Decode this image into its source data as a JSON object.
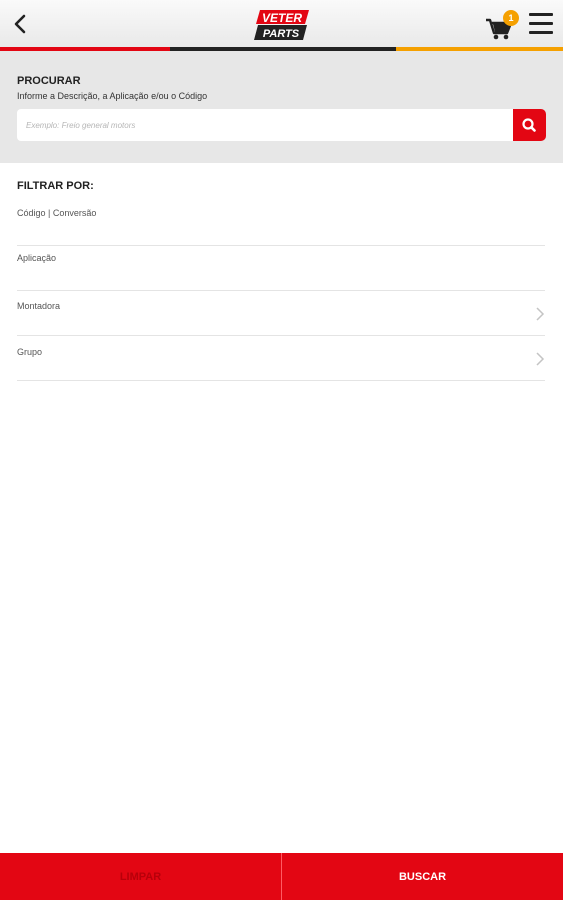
{
  "header": {
    "logo_top": "VETER",
    "logo_bottom": "PARTS",
    "cart_count": "1",
    "icons": [
      "chevron-left-icon",
      "cart-icon",
      "hamburger-menu-icon"
    ]
  },
  "progress_colors": [
    "#e30613",
    "#222222",
    "#f5a000"
  ],
  "search": {
    "title": "PROCURAR",
    "subtitle": "Informe a Descrição, a Aplicação e/ou o Código",
    "placeholder": "Exemplo: Freio general motors",
    "button_icon": "search-icon"
  },
  "filters": {
    "title": "FILTRAR POR:",
    "items": [
      {
        "label": "Código | Conversão",
        "has_chevron": false
      },
      {
        "label": "Aplicação",
        "has_chevron": false
      },
      {
        "label": "Montadora",
        "has_chevron": true
      },
      {
        "label": "Grupo",
        "has_chevron": true
      }
    ]
  },
  "actions": {
    "clear_label": "LIMPAR",
    "search_label": "BUSCAR"
  },
  "colors": {
    "brand_red": "#e30613",
    "badge_orange": "#f5a000"
  }
}
